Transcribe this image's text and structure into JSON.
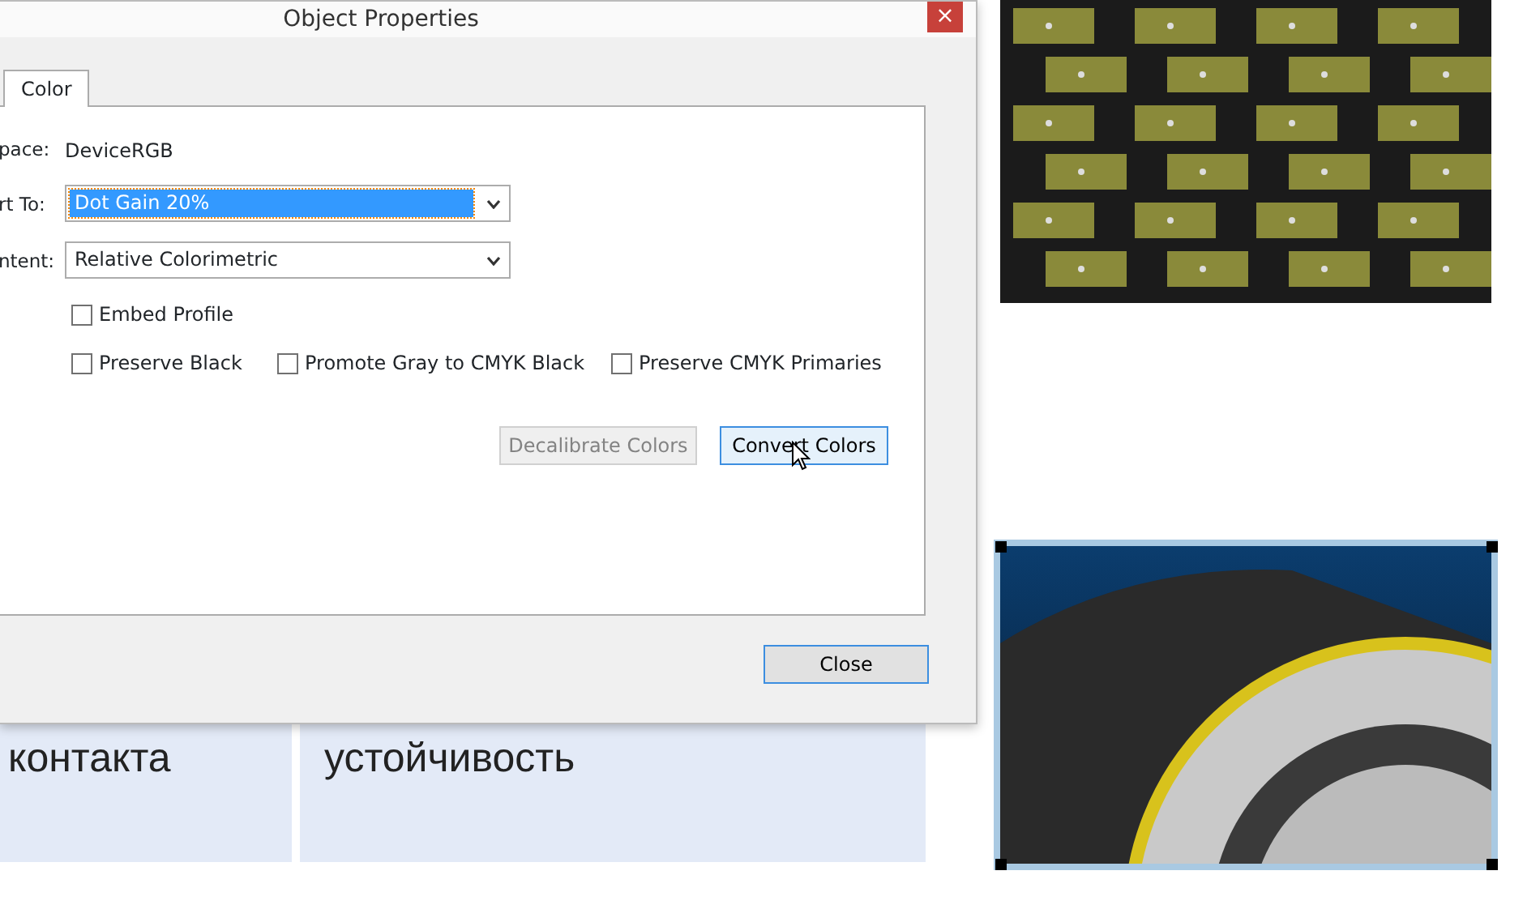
{
  "background_panels": [
    {
      "text": "контакта"
    },
    {
      "text": "устойчивость"
    }
  ],
  "images": [
    {
      "kind": "tread",
      "selected": false
    },
    {
      "kind": "tire",
      "selected": true
    }
  ],
  "dialog": {
    "title": "Object Properties",
    "close_glyph": "×",
    "tabs": [
      {
        "label": "Color",
        "selected": true
      }
    ],
    "fields": [
      {
        "kind": "text",
        "label": "pace:",
        "value": "DeviceRGB"
      },
      {
        "kind": "select",
        "label": "rt To:",
        "value": "Dot Gain 20%",
        "highlighted": true
      },
      {
        "kind": "select",
        "label": "ntent:",
        "value": "Relative Colorimetric",
        "highlighted": false
      }
    ],
    "checkbox_rows": [
      [
        {
          "label": "Embed Profile",
          "checked": false
        }
      ],
      [
        {
          "label": "Preserve Black",
          "checked": false
        },
        {
          "label": "Promote Gray to CMYK Black",
          "checked": false
        },
        {
          "label": "Preserve CMYK Primaries",
          "checked": false
        }
      ]
    ],
    "buttons": [
      {
        "label": "Decalibrate Colors",
        "disabled": true,
        "hovered": false
      },
      {
        "label": "Convert Colors",
        "disabled": false,
        "hovered": true
      }
    ],
    "close_button": "Close"
  }
}
